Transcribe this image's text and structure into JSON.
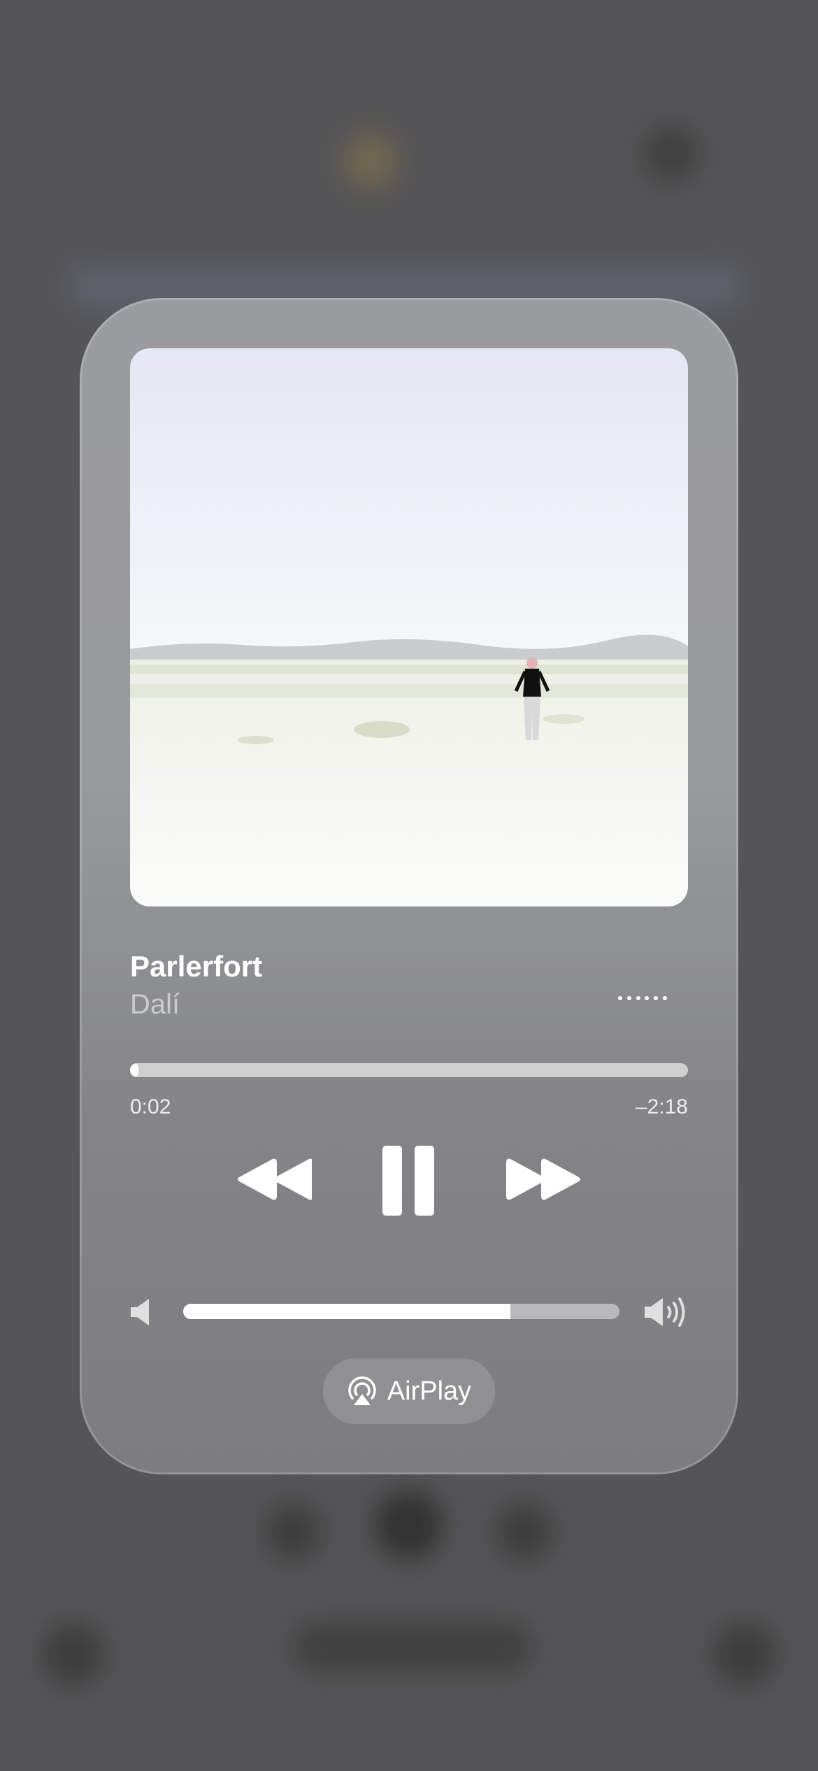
{
  "player": {
    "title": "Parlerfort",
    "artist": "Dalí",
    "elapsed": "0:02",
    "remaining": "–2:18",
    "progress_fraction": 0.015,
    "volume_fraction": 0.75,
    "airplay_label": "AirPlay"
  },
  "icons": {
    "more": "ellipsis-icon",
    "rewind": "backward-icon",
    "pause": "pause-icon",
    "forward": "forward-icon",
    "volume_low": "speaker-low-icon",
    "volume_high": "speaker-high-icon",
    "airplay": "airplay-icon"
  },
  "colors": {
    "card": "#999a9c",
    "background": "#555557",
    "accent": "#ffffff"
  }
}
